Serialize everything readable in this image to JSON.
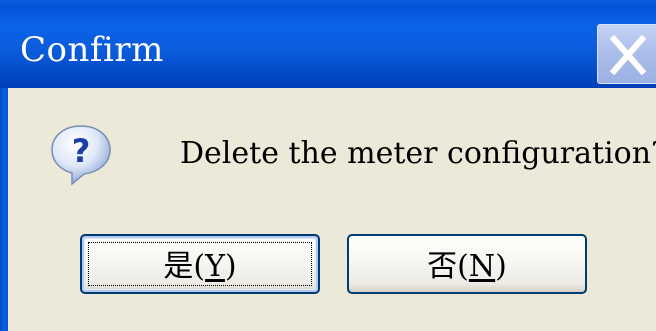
{
  "window": {
    "title": "Confirm",
    "close_icon": "close-icon"
  },
  "message": {
    "icon": "question-icon",
    "text": "Delete the meter configuration?"
  },
  "buttons": {
    "yes": {
      "prefix": "是(",
      "mnemonic": "Y",
      "suffix": ")",
      "focused": true
    },
    "no": {
      "prefix": "否(",
      "mnemonic": "N",
      "suffix": ")"
    }
  },
  "colors": {
    "titlebar": "#0553d8",
    "dialog_bg": "#ece9d8",
    "button_border": "#003c74",
    "title_text": "#ffffff"
  }
}
